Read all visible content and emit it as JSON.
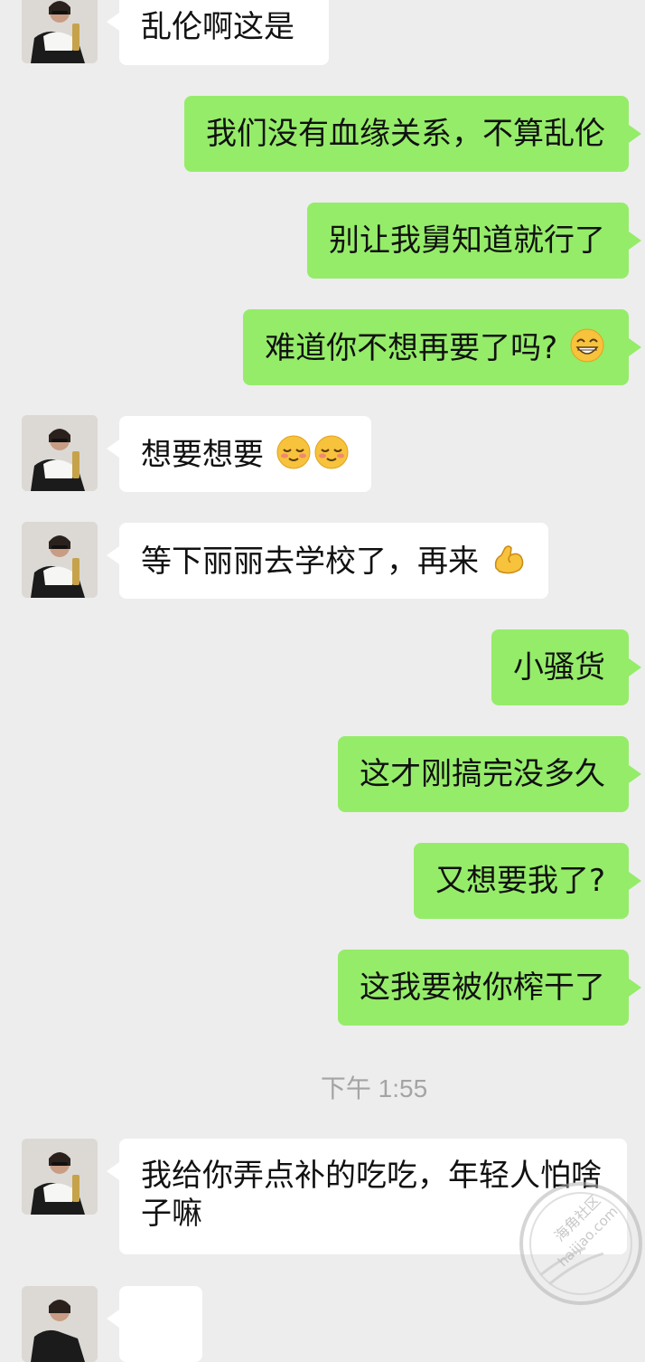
{
  "messages": [
    {
      "side": "in",
      "text": "乱伦啊这是"
    },
    {
      "side": "out",
      "text": "我们没有血缘关系，不算乱伦"
    },
    {
      "side": "out",
      "text": "别让我舅知道就行了"
    },
    {
      "side": "out",
      "text": "难道你不想再要了吗?",
      "emoji": [
        "grin-emoji"
      ]
    },
    {
      "side": "in",
      "text": "想要想要",
      "emoji": [
        "shy-emoji",
        "shy-emoji"
      ]
    },
    {
      "side": "in",
      "text": "等下丽丽去学校了，再来",
      "emoji": [
        "flex-emoji"
      ]
    },
    {
      "side": "out",
      "text": "小骚货"
    },
    {
      "side": "out",
      "text": "这才刚搞完没多久"
    },
    {
      "side": "out",
      "text": "又想要我了?"
    },
    {
      "side": "out",
      "text": "这我要被你榨干了"
    },
    {
      "side": "in",
      "text": "我给你弄点补的吃吃，年轻人怕啥子嘛"
    }
  ],
  "timestamp": "下午 1:55",
  "watermark": {
    "cn": "海角社区",
    "url": "haijiao.com"
  },
  "colors": {
    "background": "#ededed",
    "outgoing": "#95ec69",
    "incoming": "#ffffff",
    "timestamp": "#a4a4a4"
  }
}
